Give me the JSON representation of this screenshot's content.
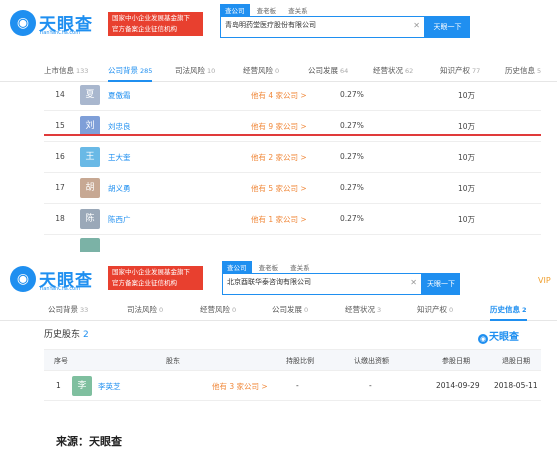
{
  "colors": {
    "accent": "#1f8ff0",
    "red": "#e8402f",
    "orange": "#f0883a",
    "vip": "#f0a030"
  },
  "header1": {
    "logo_glyph": "🔍",
    "logo_text": "天眼查",
    "logo_sub": "TianYanCha.com",
    "badge_line1": "国家中小企业发展基金旗下",
    "badge_line2": "官方备案企业征信机构",
    "search_tabs": [
      "查公司",
      "查老板",
      "查关系"
    ],
    "search_value": "青岛明药堂医疗股份有限公司",
    "search_button": "天眼一下"
  },
  "tabs1": [
    {
      "label": "上市信息",
      "count": "133"
    },
    {
      "label": "公司背景",
      "count": "285"
    },
    {
      "label": "司法风险",
      "count": "10"
    },
    {
      "label": "经营风险",
      "count": "0"
    },
    {
      "label": "公司发展",
      "count": "64"
    },
    {
      "label": "经营状况",
      "count": "62"
    },
    {
      "label": "知识产权",
      "count": "77"
    },
    {
      "label": "历史信息",
      "count": "5"
    }
  ],
  "table1": {
    "rows": [
      {
        "index": "14",
        "avatar": "夏",
        "avatar_color": "#a9b7ce",
        "name": "夏傲霜",
        "link": "他有 4 家公司 >",
        "pct": "0.27%",
        "amount": "10万"
      },
      {
        "index": "15",
        "avatar": "刘",
        "avatar_color": "#7f9fd8",
        "name": "刘忠良",
        "link": "他有 9 家公司 >",
        "pct": "0.27%",
        "amount": "10万"
      },
      {
        "index": "16",
        "avatar": "王",
        "avatar_color": "#69b9e6",
        "name": "王大奎",
        "link": "他有 2 家公司 >",
        "pct": "0.27%",
        "amount": "10万"
      },
      {
        "index": "17",
        "avatar": "胡",
        "avatar_color": "#c7a893",
        "name": "胡义勇",
        "link": "他有 5 家公司 >",
        "pct": "0.27%",
        "amount": "10万"
      },
      {
        "index": "18",
        "avatar": "陈",
        "avatar_color": "#9aa8b8",
        "name": "陈西广",
        "link": "他有 1 家公司 >",
        "pct": "0.27%",
        "amount": "10万"
      }
    ],
    "partial_avatar_color": "#7bb2a6"
  },
  "header2": {
    "logo_glyph": "🔍",
    "logo_text": "天眼查",
    "logo_sub": "TianYanCha.com",
    "badge_line1": "国家中小企业发展基金旗下",
    "badge_line2": "官方备案企业征信机构",
    "search_tabs": [
      "查公司",
      "查老板",
      "查关系"
    ],
    "search_value": "北京酉联华泰咨询有限公司",
    "search_button": "天眼一下",
    "vip": "VIP"
  },
  "tabs2": [
    {
      "label": "公司背景",
      "count": "33"
    },
    {
      "label": "司法风险",
      "count": "0"
    },
    {
      "label": "经营风险",
      "count": "0"
    },
    {
      "label": "公司发展",
      "count": "0"
    },
    {
      "label": "经营状况",
      "count": "3"
    },
    {
      "label": "知识产权",
      "count": "0"
    },
    {
      "label": "历史信息",
      "count": "2"
    }
  ],
  "section2": {
    "title": "历史股东",
    "count": "2",
    "brand": "天眼查",
    "brand_glyph": "◉",
    "columns": [
      "序号",
      "股东",
      "持股比例",
      "认缴出资额",
      "参股日期",
      "退股日期"
    ],
    "row": {
      "index": "1",
      "avatar": "李",
      "avatar_color": "#7fbf9f",
      "name": "李英芝",
      "link": "他有 3 家公司 >",
      "ratio": "-",
      "capital": "-",
      "join_date": "2014-09-29",
      "exit_date": "2018-05-11"
    }
  },
  "caption": "来源：天眼查"
}
